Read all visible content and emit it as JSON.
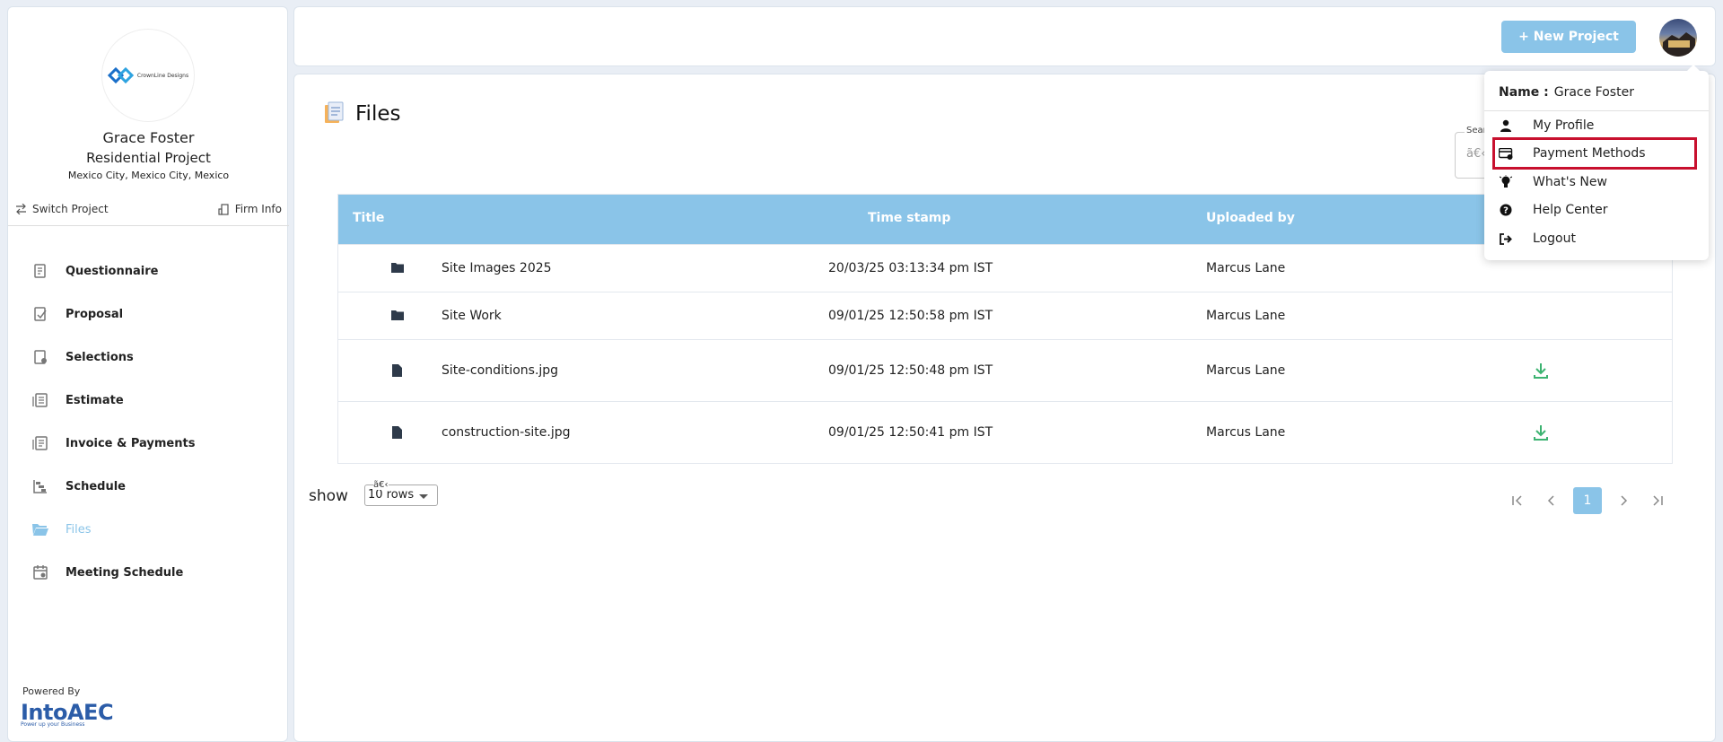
{
  "sidebar": {
    "logo_text": "CrownLine Designs",
    "profile_name": "Grace Foster",
    "project_type": "Residential Project",
    "location": "Mexico City, Mexico City, Mexico",
    "switch_project": "Switch Project",
    "firm_info": "Firm Info",
    "menu": [
      {
        "label": "Questionnaire",
        "icon": "questionnaire-icon"
      },
      {
        "label": "Proposal",
        "icon": "proposal-icon"
      },
      {
        "label": "Selections",
        "icon": "selections-icon"
      },
      {
        "label": "Estimate",
        "icon": "estimate-icon"
      },
      {
        "label": "Invoice & Payments",
        "icon": "invoice-icon"
      },
      {
        "label": "Schedule",
        "icon": "schedule-icon"
      },
      {
        "label": "Files",
        "icon": "folder-open-icon",
        "active": true
      },
      {
        "label": "Meeting Schedule",
        "icon": "calendar-icon"
      }
    ],
    "powered_by": "Powered By",
    "brand_name": "IntoAEC",
    "brand_tagline": "Power up your Business"
  },
  "topbar": {
    "new_project": "+ New Project"
  },
  "files": {
    "title": "Files",
    "search_label": "Search file nar",
    "search_value": "ã€‹",
    "columns": [
      "Title",
      "Time stamp",
      "Uploaded by"
    ],
    "rows": [
      {
        "type": "folder",
        "title": "Site Images 2025",
        "timestamp": "20/03/25 03:13:34 pm IST",
        "uploaded_by": "Marcus Lane",
        "download": false
      },
      {
        "type": "folder",
        "title": "Site Work",
        "timestamp": "09/01/25 12:50:58 pm IST",
        "uploaded_by": "Marcus Lane",
        "download": false
      },
      {
        "type": "file",
        "title": "Site-conditions.jpg",
        "timestamp": "09/01/25 12:50:48 pm IST",
        "uploaded_by": "Marcus Lane",
        "download": true
      },
      {
        "type": "file",
        "title": "construction-site.jpg",
        "timestamp": "09/01/25 12:50:41 pm IST",
        "uploaded_by": "Marcus Lane",
        "download": true
      }
    ],
    "show_label": "show",
    "rows_label": "ã€‹",
    "rows_value": "10 rows",
    "current_page": "1"
  },
  "user_menu": {
    "name_label": "Name :",
    "name_value": "Grace Foster",
    "items": [
      {
        "label": "My Profile",
        "icon": "user-icon"
      },
      {
        "label": "Payment Methods",
        "icon": "credit-card-icon",
        "highlighted": true
      },
      {
        "label": "What's New",
        "icon": "lightbulb-icon"
      },
      {
        "label": "Help Center",
        "icon": "help-icon"
      },
      {
        "label": "Logout",
        "icon": "logout-icon"
      }
    ]
  },
  "colors": {
    "accent": "#8ac4e8",
    "download": "#3cb371",
    "highlight": "#c8102e"
  }
}
